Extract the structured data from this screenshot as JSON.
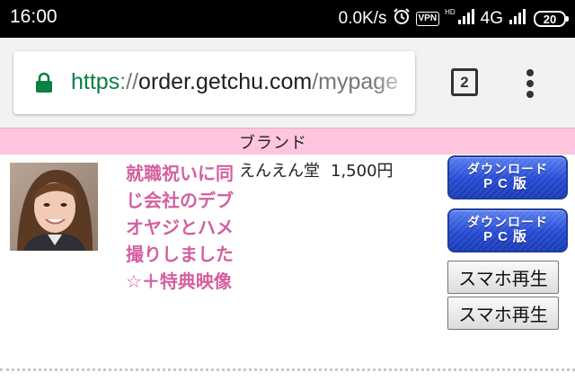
{
  "status_bar": {
    "time": "16:00",
    "net_speed": "0.0K/s",
    "vpn": "VPN",
    "hd": "HD",
    "network": "4G",
    "battery": "20"
  },
  "browser": {
    "url_scheme": "https",
    "url_separator": "://",
    "url_host": "order.getchu.com",
    "url_path": "/mypage",
    "tab_count": "2"
  },
  "page": {
    "header_label": "ブランド",
    "item": {
      "title": "就職祝いに同じ会社のデブオヤジとハメ撮りしました☆＋特典映像",
      "brand": "えんえん堂",
      "price": "1,500円"
    },
    "buttons": {
      "download_1_line1": "ダウンロード",
      "download_1_line2": "PC版",
      "download_2_line1": "ダウンロード",
      "download_2_line2": "PC版",
      "smartphone_play_1": "スマホ再生",
      "smartphone_play_2": "スマホ再生"
    }
  },
  "colors": {
    "header_pink": "#ffc5df",
    "title_pink": "#d45f9f",
    "secure_green": "#0b8043",
    "download_blue": "#2549d1"
  }
}
